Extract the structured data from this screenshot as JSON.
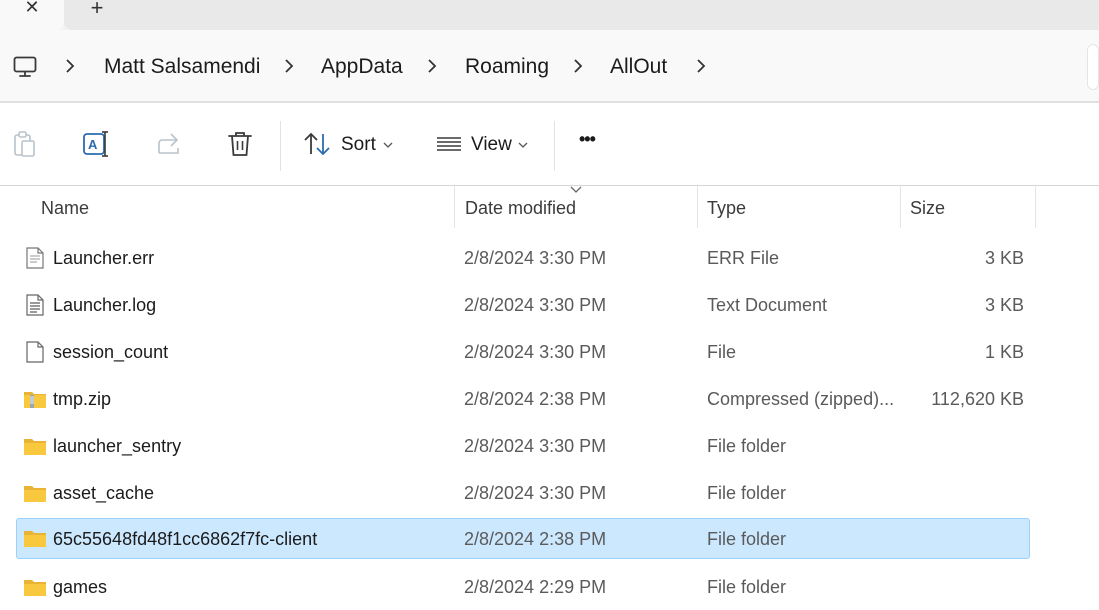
{
  "tabs": {
    "close_glyph": "✕",
    "new_glyph": "+"
  },
  "breadcrumb": {
    "items": [
      "Matt Salsamendi",
      "AppData",
      "Roaming",
      "AllOut"
    ]
  },
  "toolbar": {
    "sort_label": "Sort",
    "view_label": "View",
    "more_label": "•••"
  },
  "columns": {
    "name": "Name",
    "date": "Date modified",
    "type": "Type",
    "size": "Size"
  },
  "files": [
    {
      "name": "Launcher.err",
      "date": "2/8/2024 3:30 PM",
      "type": "ERR File",
      "size": "3 KB",
      "icon": "file-lines-icon"
    },
    {
      "name": "Launcher.log",
      "date": "2/8/2024 3:30 PM",
      "type": "Text Document",
      "size": "3 KB",
      "icon": "text-document-icon"
    },
    {
      "name": "session_count",
      "date": "2/8/2024 3:30 PM",
      "type": "File",
      "size": "1 KB",
      "icon": "blank-file-icon"
    },
    {
      "name": "tmp.zip",
      "date": "2/8/2024 2:38 PM",
      "type": "Compressed (zipped)...",
      "size": "112,620 KB",
      "icon": "zip-folder-icon"
    },
    {
      "name": "launcher_sentry",
      "date": "2/8/2024 3:30 PM",
      "type": "File folder",
      "size": "",
      "icon": "folder-icon"
    },
    {
      "name": "asset_cache",
      "date": "2/8/2024 3:30 PM",
      "type": "File folder",
      "size": "",
      "icon": "folder-icon"
    },
    {
      "name": "65c55648fd48f1cc6862f7fc-client",
      "date": "2/8/2024 2:38 PM",
      "type": "File folder",
      "size": "",
      "icon": "folder-icon",
      "selected": true
    },
    {
      "name": "games",
      "date": "2/8/2024 2:29 PM",
      "type": "File folder",
      "size": "",
      "icon": "folder-icon"
    }
  ],
  "colors": {
    "selection_bg": "#cce8ff",
    "selection_border": "#99d1ff",
    "folder_yellow": "#f8c93f",
    "accent_blue": "#2b6cb0"
  }
}
